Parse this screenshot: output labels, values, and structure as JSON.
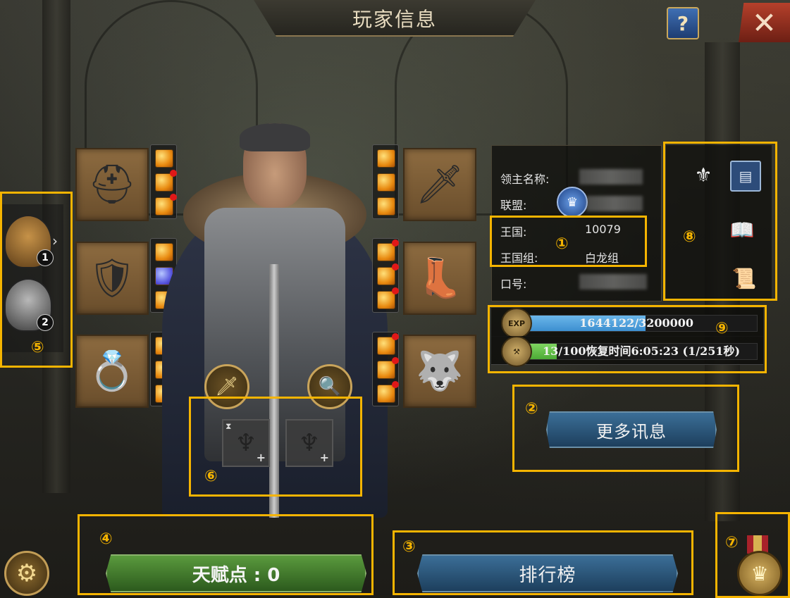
{
  "header": {
    "title": "玩家信息",
    "help_label": "?",
    "close_label": "✕"
  },
  "profile": {
    "lord_name_label": "领主名称:",
    "alliance_label": "联盟:",
    "kingdom_label": "王国:",
    "kingdom_value": "10079",
    "kingdom_group_label": "王国组:",
    "kingdom_group_value": "白龙组",
    "slogan_label": "口号:"
  },
  "bars": {
    "exp": {
      "icon": "EXP",
      "text": "1644122/3200000",
      "progress": 0.514,
      "color": "#3d8fd0"
    },
    "stamina": {
      "text": "13/100恢复时间6:05:23 (1/251秒)",
      "progress": 0.13,
      "color": "#4caa36"
    }
  },
  "buttons": {
    "more_info": "更多讯息",
    "ranking": "排行榜",
    "talent": "天赋点 : 0"
  },
  "sidebar": {
    "avatars": [
      {
        "num": "1"
      },
      {
        "num": "2"
      }
    ]
  },
  "annotations": {
    "n1": "①",
    "n2": "②",
    "n3": "③",
    "n4": "④",
    "n5": "⑤",
    "n6": "⑥",
    "n7": "⑦",
    "n8": "⑧",
    "n9": "⑨"
  },
  "icons": {
    "equipment": [
      "horned-helmet-icon",
      "chest-armor-icon",
      "ring-icon",
      "sword-icon",
      "greaves-icon",
      "amulet-icon"
    ],
    "profile_tools": [
      "helmet-quill-icon",
      "document-icon",
      "book-icon",
      "scroll-quill-icon"
    ],
    "misc": [
      "gear-icon",
      "medal-icon",
      "sword-medallion-icon",
      "magnifier-medallion-icon"
    ]
  },
  "colors": {
    "accent": "#f5b400",
    "button_blue": "#2b5679",
    "button_green": "#3e7a2b"
  }
}
